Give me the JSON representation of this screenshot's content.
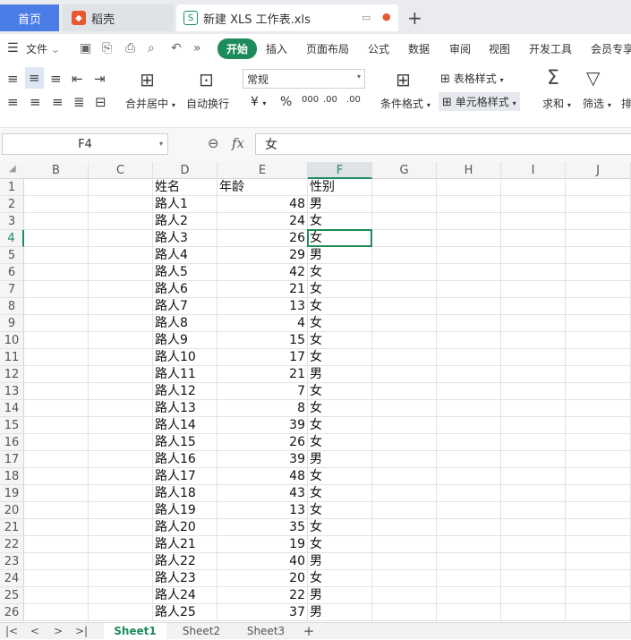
{
  "tabs": {
    "home": "首页",
    "daoke": "稻壳",
    "doc": "新建 XLS 工作表.xls",
    "plus": "+"
  },
  "menu": {
    "file": "文件",
    "items": [
      "开始",
      "插入",
      "页面布局",
      "公式",
      "数据",
      "审阅",
      "视图",
      "开发工具",
      "会员专享"
    ]
  },
  "ribbon": {
    "merge": "合并居中",
    "wrap": "自动换行",
    "number_format": "常规",
    "currency": "¥",
    "percent": "%",
    "thousands": "000",
    "dec_inc": ".00",
    "dec_dec": ".00",
    "table_style": "表格样式",
    "cond_format": "条件格式",
    "cell_style": "单元格样式",
    "sum": "求和",
    "filter": "筛选",
    "sort": "排"
  },
  "formula": {
    "cell_ref": "F4",
    "fx": "fx",
    "value": "女"
  },
  "columns": [
    "B",
    "C",
    "D",
    "E",
    "F",
    "G",
    "H",
    "I",
    "J"
  ],
  "selected": {
    "col": "F",
    "row": 4
  },
  "header": {
    "name": "姓名",
    "age": "年龄",
    "gender": "性别"
  },
  "rows": [
    {
      "n": 2,
      "name": "路人1",
      "age": "48",
      "g": "男"
    },
    {
      "n": 3,
      "name": "路人2",
      "age": "24",
      "g": "女"
    },
    {
      "n": 4,
      "name": "路人3",
      "age": "26",
      "g": "女"
    },
    {
      "n": 5,
      "name": "路人4",
      "age": "29",
      "g": "男"
    },
    {
      "n": 6,
      "name": "路人5",
      "age": "42",
      "g": "女"
    },
    {
      "n": 7,
      "name": "路人6",
      "age": "21",
      "g": "女"
    },
    {
      "n": 8,
      "name": "路人7",
      "age": "13",
      "g": "女"
    },
    {
      "n": 9,
      "name": "路人8",
      "age": "4",
      "g": "女"
    },
    {
      "n": 10,
      "name": "路人9",
      "age": "15",
      "g": "女"
    },
    {
      "n": 11,
      "name": "路人10",
      "age": "17",
      "g": "女"
    },
    {
      "n": 12,
      "name": "路人11",
      "age": "21",
      "g": "男"
    },
    {
      "n": 13,
      "name": "路人12",
      "age": "7",
      "g": "女"
    },
    {
      "n": 14,
      "name": "路人13",
      "age": "8",
      "g": "女"
    },
    {
      "n": 15,
      "name": "路人14",
      "age": "39",
      "g": "女"
    },
    {
      "n": 16,
      "name": "路人15",
      "age": "26",
      "g": "女"
    },
    {
      "n": 17,
      "name": "路人16",
      "age": "39",
      "g": "男"
    },
    {
      "n": 18,
      "name": "路人17",
      "age": "48",
      "g": "女"
    },
    {
      "n": 19,
      "name": "路人18",
      "age": "43",
      "g": "女"
    },
    {
      "n": 20,
      "name": "路人19",
      "age": "13",
      "g": "女"
    },
    {
      "n": 21,
      "name": "路人20",
      "age": "35",
      "g": "女"
    },
    {
      "n": 22,
      "name": "路人21",
      "age": "19",
      "g": "女"
    },
    {
      "n": 23,
      "name": "路人22",
      "age": "40",
      "g": "男"
    },
    {
      "n": 24,
      "name": "路人23",
      "age": "20",
      "g": "女"
    },
    {
      "n": 25,
      "name": "路人24",
      "age": "22",
      "g": "男"
    },
    {
      "n": 26,
      "name": "路人25",
      "age": "37",
      "g": "男"
    }
  ],
  "sheets": [
    "Sheet1",
    "Sheet2",
    "Sheet3"
  ],
  "sheet_nav": [
    "|<",
    "<",
    ">",
    ">|",
    "+"
  ]
}
